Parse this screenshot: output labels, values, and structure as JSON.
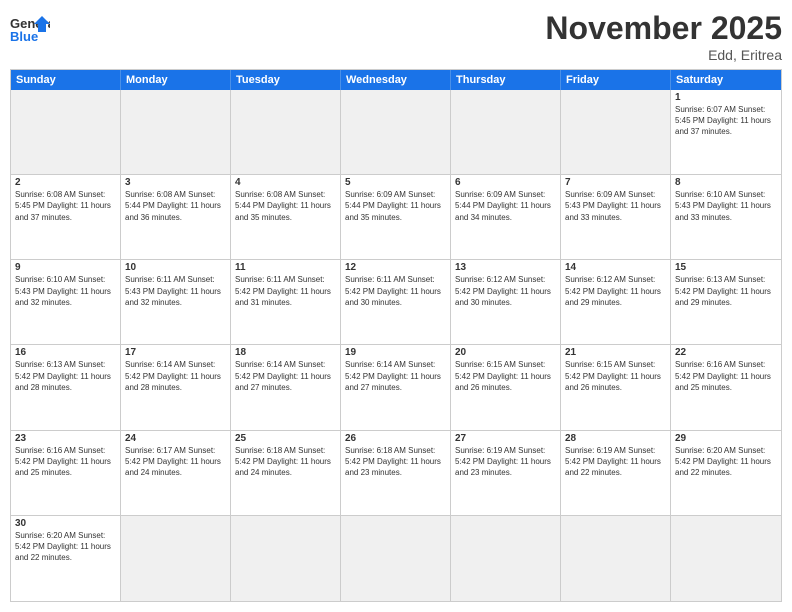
{
  "header": {
    "logo_general": "General",
    "logo_blue": "Blue",
    "month_title": "November 2025",
    "subtitle": "Edd, Eritrea"
  },
  "days_of_week": [
    "Sunday",
    "Monday",
    "Tuesday",
    "Wednesday",
    "Thursday",
    "Friday",
    "Saturday"
  ],
  "rows": [
    {
      "cells": [
        {
          "day": "",
          "info": "",
          "shaded": true
        },
        {
          "day": "",
          "info": "",
          "shaded": true
        },
        {
          "day": "",
          "info": "",
          "shaded": true
        },
        {
          "day": "",
          "info": "",
          "shaded": true
        },
        {
          "day": "",
          "info": "",
          "shaded": true
        },
        {
          "day": "",
          "info": "",
          "shaded": true
        },
        {
          "day": "1",
          "info": "Sunrise: 6:07 AM\nSunset: 5:45 PM\nDaylight: 11 hours and 37 minutes."
        }
      ]
    },
    {
      "cells": [
        {
          "day": "2",
          "info": "Sunrise: 6:08 AM\nSunset: 5:45 PM\nDaylight: 11 hours and 37 minutes."
        },
        {
          "day": "3",
          "info": "Sunrise: 6:08 AM\nSunset: 5:44 PM\nDaylight: 11 hours and 36 minutes."
        },
        {
          "day": "4",
          "info": "Sunrise: 6:08 AM\nSunset: 5:44 PM\nDaylight: 11 hours and 35 minutes."
        },
        {
          "day": "5",
          "info": "Sunrise: 6:09 AM\nSunset: 5:44 PM\nDaylight: 11 hours and 35 minutes."
        },
        {
          "day": "6",
          "info": "Sunrise: 6:09 AM\nSunset: 5:44 PM\nDaylight: 11 hours and 34 minutes."
        },
        {
          "day": "7",
          "info": "Sunrise: 6:09 AM\nSunset: 5:43 PM\nDaylight: 11 hours and 33 minutes."
        },
        {
          "day": "8",
          "info": "Sunrise: 6:10 AM\nSunset: 5:43 PM\nDaylight: 11 hours and 33 minutes."
        }
      ]
    },
    {
      "cells": [
        {
          "day": "9",
          "info": "Sunrise: 6:10 AM\nSunset: 5:43 PM\nDaylight: 11 hours and 32 minutes."
        },
        {
          "day": "10",
          "info": "Sunrise: 6:11 AM\nSunset: 5:43 PM\nDaylight: 11 hours and 32 minutes."
        },
        {
          "day": "11",
          "info": "Sunrise: 6:11 AM\nSunset: 5:42 PM\nDaylight: 11 hours and 31 minutes."
        },
        {
          "day": "12",
          "info": "Sunrise: 6:11 AM\nSunset: 5:42 PM\nDaylight: 11 hours and 30 minutes."
        },
        {
          "day": "13",
          "info": "Sunrise: 6:12 AM\nSunset: 5:42 PM\nDaylight: 11 hours and 30 minutes."
        },
        {
          "day": "14",
          "info": "Sunrise: 6:12 AM\nSunset: 5:42 PM\nDaylight: 11 hours and 29 minutes."
        },
        {
          "day": "15",
          "info": "Sunrise: 6:13 AM\nSunset: 5:42 PM\nDaylight: 11 hours and 29 minutes."
        }
      ]
    },
    {
      "cells": [
        {
          "day": "16",
          "info": "Sunrise: 6:13 AM\nSunset: 5:42 PM\nDaylight: 11 hours and 28 minutes."
        },
        {
          "day": "17",
          "info": "Sunrise: 6:14 AM\nSunset: 5:42 PM\nDaylight: 11 hours and 28 minutes."
        },
        {
          "day": "18",
          "info": "Sunrise: 6:14 AM\nSunset: 5:42 PM\nDaylight: 11 hours and 27 minutes."
        },
        {
          "day": "19",
          "info": "Sunrise: 6:14 AM\nSunset: 5:42 PM\nDaylight: 11 hours and 27 minutes."
        },
        {
          "day": "20",
          "info": "Sunrise: 6:15 AM\nSunset: 5:42 PM\nDaylight: 11 hours and 26 minutes."
        },
        {
          "day": "21",
          "info": "Sunrise: 6:15 AM\nSunset: 5:42 PM\nDaylight: 11 hours and 26 minutes."
        },
        {
          "day": "22",
          "info": "Sunrise: 6:16 AM\nSunset: 5:42 PM\nDaylight: 11 hours and 25 minutes."
        }
      ]
    },
    {
      "cells": [
        {
          "day": "23",
          "info": "Sunrise: 6:16 AM\nSunset: 5:42 PM\nDaylight: 11 hours and 25 minutes."
        },
        {
          "day": "24",
          "info": "Sunrise: 6:17 AM\nSunset: 5:42 PM\nDaylight: 11 hours and 24 minutes."
        },
        {
          "day": "25",
          "info": "Sunrise: 6:18 AM\nSunset: 5:42 PM\nDaylight: 11 hours and 24 minutes."
        },
        {
          "day": "26",
          "info": "Sunrise: 6:18 AM\nSunset: 5:42 PM\nDaylight: 11 hours and 23 minutes."
        },
        {
          "day": "27",
          "info": "Sunrise: 6:19 AM\nSunset: 5:42 PM\nDaylight: 11 hours and 23 minutes."
        },
        {
          "day": "28",
          "info": "Sunrise: 6:19 AM\nSunset: 5:42 PM\nDaylight: 11 hours and 22 minutes."
        },
        {
          "day": "29",
          "info": "Sunrise: 6:20 AM\nSunset: 5:42 PM\nDaylight: 11 hours and 22 minutes."
        }
      ]
    },
    {
      "cells": [
        {
          "day": "30",
          "info": "Sunrise: 6:20 AM\nSunset: 5:42 PM\nDaylight: 11 hours and 22 minutes."
        },
        {
          "day": "",
          "info": "",
          "shaded": true
        },
        {
          "day": "",
          "info": "",
          "shaded": true
        },
        {
          "day": "",
          "info": "",
          "shaded": true
        },
        {
          "day": "",
          "info": "",
          "shaded": true
        },
        {
          "day": "",
          "info": "",
          "shaded": true
        },
        {
          "day": "",
          "info": "",
          "shaded": true
        }
      ]
    }
  ]
}
